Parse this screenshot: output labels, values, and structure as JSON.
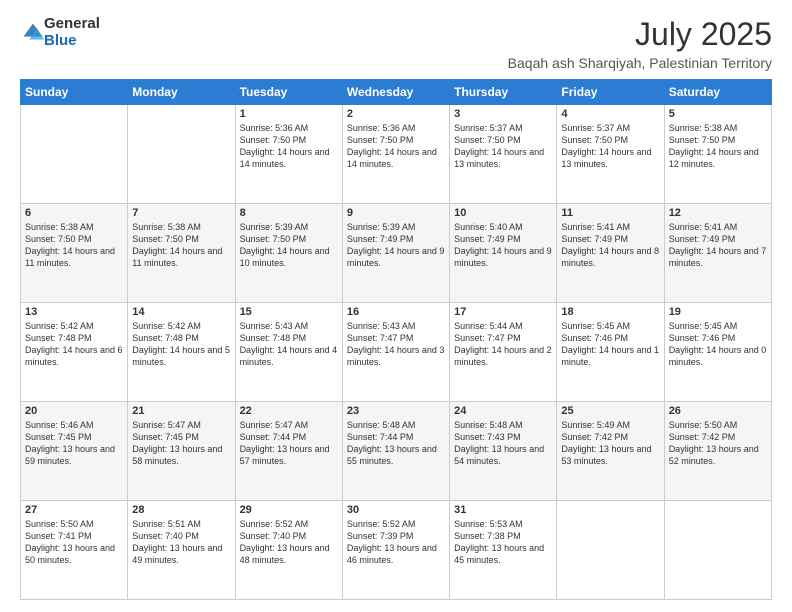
{
  "logo": {
    "general": "General",
    "blue": "Blue"
  },
  "header": {
    "month": "July 2025",
    "location": "Baqah ash Sharqiyah, Palestinian Territory"
  },
  "days": [
    "Sunday",
    "Monday",
    "Tuesday",
    "Wednesday",
    "Thursday",
    "Friday",
    "Saturday"
  ],
  "weeks": [
    [
      {
        "day": "",
        "info": ""
      },
      {
        "day": "",
        "info": ""
      },
      {
        "day": "1",
        "info": "Sunrise: 5:36 AM\nSunset: 7:50 PM\nDaylight: 14 hours and 14 minutes."
      },
      {
        "day": "2",
        "info": "Sunrise: 5:36 AM\nSunset: 7:50 PM\nDaylight: 14 hours and 14 minutes."
      },
      {
        "day": "3",
        "info": "Sunrise: 5:37 AM\nSunset: 7:50 PM\nDaylight: 14 hours and 13 minutes."
      },
      {
        "day": "4",
        "info": "Sunrise: 5:37 AM\nSunset: 7:50 PM\nDaylight: 14 hours and 13 minutes."
      },
      {
        "day": "5",
        "info": "Sunrise: 5:38 AM\nSunset: 7:50 PM\nDaylight: 14 hours and 12 minutes."
      }
    ],
    [
      {
        "day": "6",
        "info": "Sunrise: 5:38 AM\nSunset: 7:50 PM\nDaylight: 14 hours and 11 minutes."
      },
      {
        "day": "7",
        "info": "Sunrise: 5:38 AM\nSunset: 7:50 PM\nDaylight: 14 hours and 11 minutes."
      },
      {
        "day": "8",
        "info": "Sunrise: 5:39 AM\nSunset: 7:50 PM\nDaylight: 14 hours and 10 minutes."
      },
      {
        "day": "9",
        "info": "Sunrise: 5:39 AM\nSunset: 7:49 PM\nDaylight: 14 hours and 9 minutes."
      },
      {
        "day": "10",
        "info": "Sunrise: 5:40 AM\nSunset: 7:49 PM\nDaylight: 14 hours and 9 minutes."
      },
      {
        "day": "11",
        "info": "Sunrise: 5:41 AM\nSunset: 7:49 PM\nDaylight: 14 hours and 8 minutes."
      },
      {
        "day": "12",
        "info": "Sunrise: 5:41 AM\nSunset: 7:49 PM\nDaylight: 14 hours and 7 minutes."
      }
    ],
    [
      {
        "day": "13",
        "info": "Sunrise: 5:42 AM\nSunset: 7:48 PM\nDaylight: 14 hours and 6 minutes."
      },
      {
        "day": "14",
        "info": "Sunrise: 5:42 AM\nSunset: 7:48 PM\nDaylight: 14 hours and 5 minutes."
      },
      {
        "day": "15",
        "info": "Sunrise: 5:43 AM\nSunset: 7:48 PM\nDaylight: 14 hours and 4 minutes."
      },
      {
        "day": "16",
        "info": "Sunrise: 5:43 AM\nSunset: 7:47 PM\nDaylight: 14 hours and 3 minutes."
      },
      {
        "day": "17",
        "info": "Sunrise: 5:44 AM\nSunset: 7:47 PM\nDaylight: 14 hours and 2 minutes."
      },
      {
        "day": "18",
        "info": "Sunrise: 5:45 AM\nSunset: 7:46 PM\nDaylight: 14 hours and 1 minute."
      },
      {
        "day": "19",
        "info": "Sunrise: 5:45 AM\nSunset: 7:46 PM\nDaylight: 14 hours and 0 minutes."
      }
    ],
    [
      {
        "day": "20",
        "info": "Sunrise: 5:46 AM\nSunset: 7:45 PM\nDaylight: 13 hours and 59 minutes."
      },
      {
        "day": "21",
        "info": "Sunrise: 5:47 AM\nSunset: 7:45 PM\nDaylight: 13 hours and 58 minutes."
      },
      {
        "day": "22",
        "info": "Sunrise: 5:47 AM\nSunset: 7:44 PM\nDaylight: 13 hours and 57 minutes."
      },
      {
        "day": "23",
        "info": "Sunrise: 5:48 AM\nSunset: 7:44 PM\nDaylight: 13 hours and 55 minutes."
      },
      {
        "day": "24",
        "info": "Sunrise: 5:48 AM\nSunset: 7:43 PM\nDaylight: 13 hours and 54 minutes."
      },
      {
        "day": "25",
        "info": "Sunrise: 5:49 AM\nSunset: 7:42 PM\nDaylight: 13 hours and 53 minutes."
      },
      {
        "day": "26",
        "info": "Sunrise: 5:50 AM\nSunset: 7:42 PM\nDaylight: 13 hours and 52 minutes."
      }
    ],
    [
      {
        "day": "27",
        "info": "Sunrise: 5:50 AM\nSunset: 7:41 PM\nDaylight: 13 hours and 50 minutes."
      },
      {
        "day": "28",
        "info": "Sunrise: 5:51 AM\nSunset: 7:40 PM\nDaylight: 13 hours and 49 minutes."
      },
      {
        "day": "29",
        "info": "Sunrise: 5:52 AM\nSunset: 7:40 PM\nDaylight: 13 hours and 48 minutes."
      },
      {
        "day": "30",
        "info": "Sunrise: 5:52 AM\nSunset: 7:39 PM\nDaylight: 13 hours and 46 minutes."
      },
      {
        "day": "31",
        "info": "Sunrise: 5:53 AM\nSunset: 7:38 PM\nDaylight: 13 hours and 45 minutes."
      },
      {
        "day": "",
        "info": ""
      },
      {
        "day": "",
        "info": ""
      }
    ]
  ]
}
